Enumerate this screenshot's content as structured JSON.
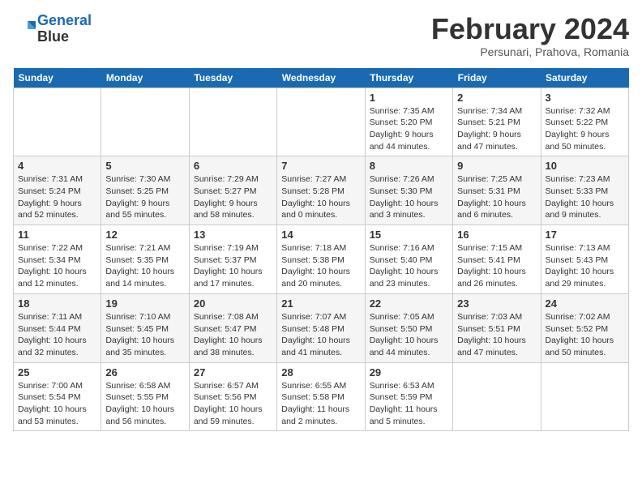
{
  "header": {
    "logo_line1": "General",
    "logo_line2": "Blue",
    "month": "February 2024",
    "location": "Persunari, Prahova, Romania"
  },
  "days_of_week": [
    "Sunday",
    "Monday",
    "Tuesday",
    "Wednesday",
    "Thursday",
    "Friday",
    "Saturday"
  ],
  "weeks": [
    [
      {
        "day": "",
        "info": ""
      },
      {
        "day": "",
        "info": ""
      },
      {
        "day": "",
        "info": ""
      },
      {
        "day": "",
        "info": ""
      },
      {
        "day": "1",
        "info": "Sunrise: 7:35 AM\nSunset: 5:20 PM\nDaylight: 9 hours and 44 minutes."
      },
      {
        "day": "2",
        "info": "Sunrise: 7:34 AM\nSunset: 5:21 PM\nDaylight: 9 hours and 47 minutes."
      },
      {
        "day": "3",
        "info": "Sunrise: 7:32 AM\nSunset: 5:22 PM\nDaylight: 9 hours and 50 minutes."
      }
    ],
    [
      {
        "day": "4",
        "info": "Sunrise: 7:31 AM\nSunset: 5:24 PM\nDaylight: 9 hours and 52 minutes."
      },
      {
        "day": "5",
        "info": "Sunrise: 7:30 AM\nSunset: 5:25 PM\nDaylight: 9 hours and 55 minutes."
      },
      {
        "day": "6",
        "info": "Sunrise: 7:29 AM\nSunset: 5:27 PM\nDaylight: 9 hours and 58 minutes."
      },
      {
        "day": "7",
        "info": "Sunrise: 7:27 AM\nSunset: 5:28 PM\nDaylight: 10 hours and 0 minutes."
      },
      {
        "day": "8",
        "info": "Sunrise: 7:26 AM\nSunset: 5:30 PM\nDaylight: 10 hours and 3 minutes."
      },
      {
        "day": "9",
        "info": "Sunrise: 7:25 AM\nSunset: 5:31 PM\nDaylight: 10 hours and 6 minutes."
      },
      {
        "day": "10",
        "info": "Sunrise: 7:23 AM\nSunset: 5:33 PM\nDaylight: 10 hours and 9 minutes."
      }
    ],
    [
      {
        "day": "11",
        "info": "Sunrise: 7:22 AM\nSunset: 5:34 PM\nDaylight: 10 hours and 12 minutes."
      },
      {
        "day": "12",
        "info": "Sunrise: 7:21 AM\nSunset: 5:35 PM\nDaylight: 10 hours and 14 minutes."
      },
      {
        "day": "13",
        "info": "Sunrise: 7:19 AM\nSunset: 5:37 PM\nDaylight: 10 hours and 17 minutes."
      },
      {
        "day": "14",
        "info": "Sunrise: 7:18 AM\nSunset: 5:38 PM\nDaylight: 10 hours and 20 minutes."
      },
      {
        "day": "15",
        "info": "Sunrise: 7:16 AM\nSunset: 5:40 PM\nDaylight: 10 hours and 23 minutes."
      },
      {
        "day": "16",
        "info": "Sunrise: 7:15 AM\nSunset: 5:41 PM\nDaylight: 10 hours and 26 minutes."
      },
      {
        "day": "17",
        "info": "Sunrise: 7:13 AM\nSunset: 5:43 PM\nDaylight: 10 hours and 29 minutes."
      }
    ],
    [
      {
        "day": "18",
        "info": "Sunrise: 7:11 AM\nSunset: 5:44 PM\nDaylight: 10 hours and 32 minutes."
      },
      {
        "day": "19",
        "info": "Sunrise: 7:10 AM\nSunset: 5:45 PM\nDaylight: 10 hours and 35 minutes."
      },
      {
        "day": "20",
        "info": "Sunrise: 7:08 AM\nSunset: 5:47 PM\nDaylight: 10 hours and 38 minutes."
      },
      {
        "day": "21",
        "info": "Sunrise: 7:07 AM\nSunset: 5:48 PM\nDaylight: 10 hours and 41 minutes."
      },
      {
        "day": "22",
        "info": "Sunrise: 7:05 AM\nSunset: 5:50 PM\nDaylight: 10 hours and 44 minutes."
      },
      {
        "day": "23",
        "info": "Sunrise: 7:03 AM\nSunset: 5:51 PM\nDaylight: 10 hours and 47 minutes."
      },
      {
        "day": "24",
        "info": "Sunrise: 7:02 AM\nSunset: 5:52 PM\nDaylight: 10 hours and 50 minutes."
      }
    ],
    [
      {
        "day": "25",
        "info": "Sunrise: 7:00 AM\nSunset: 5:54 PM\nDaylight: 10 hours and 53 minutes."
      },
      {
        "day": "26",
        "info": "Sunrise: 6:58 AM\nSunset: 5:55 PM\nDaylight: 10 hours and 56 minutes."
      },
      {
        "day": "27",
        "info": "Sunrise: 6:57 AM\nSunset: 5:56 PM\nDaylight: 10 hours and 59 minutes."
      },
      {
        "day": "28",
        "info": "Sunrise: 6:55 AM\nSunset: 5:58 PM\nDaylight: 11 hours and 2 minutes."
      },
      {
        "day": "29",
        "info": "Sunrise: 6:53 AM\nSunset: 5:59 PM\nDaylight: 11 hours and 5 minutes."
      },
      {
        "day": "",
        "info": ""
      },
      {
        "day": "",
        "info": ""
      }
    ]
  ]
}
